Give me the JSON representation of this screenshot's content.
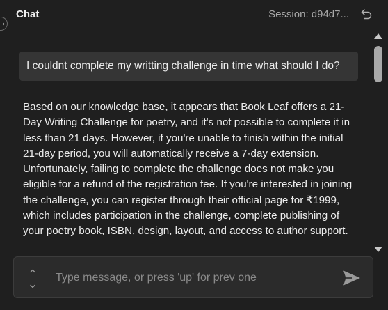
{
  "header": {
    "title": "Chat",
    "session_label": "Session: d94d7..."
  },
  "messages": [
    {
      "role": "user",
      "text": "I couldnt complete my writting challenge in time what should I do?"
    },
    {
      "role": "assistant",
      "text": "Based on our knowledge base, it appears that Book Leaf offers a 21-Day Writing Challenge for poetry, and it's not possible to complete it in less than 21 days. However, if you're unable to finish within the initial 21-day period, you will automatically receive a 7-day extension. Unfortunately, failing to complete the challenge does not make you eligible for a refund of the registration fee. If you're interested in joining the challenge, you can register through their official page for ₹1999, which includes participation in the challenge, complete publishing of your poetry book, ISBN, design, layout, and access to author support."
    }
  ],
  "input": {
    "value": "",
    "placeholder": "Type message, or press 'up' for prev one"
  },
  "icons": {
    "collapse": "chevron-right-icon",
    "undo": "undo-icon",
    "history_up": "chevron-up-icon",
    "history_down": "chevron-down-icon",
    "send": "send-icon"
  },
  "colors": {
    "background": "#1f1f1f",
    "user_bubble": "#353535",
    "input_background": "#2b2b2b",
    "muted_text": "#8a8a8a"
  }
}
